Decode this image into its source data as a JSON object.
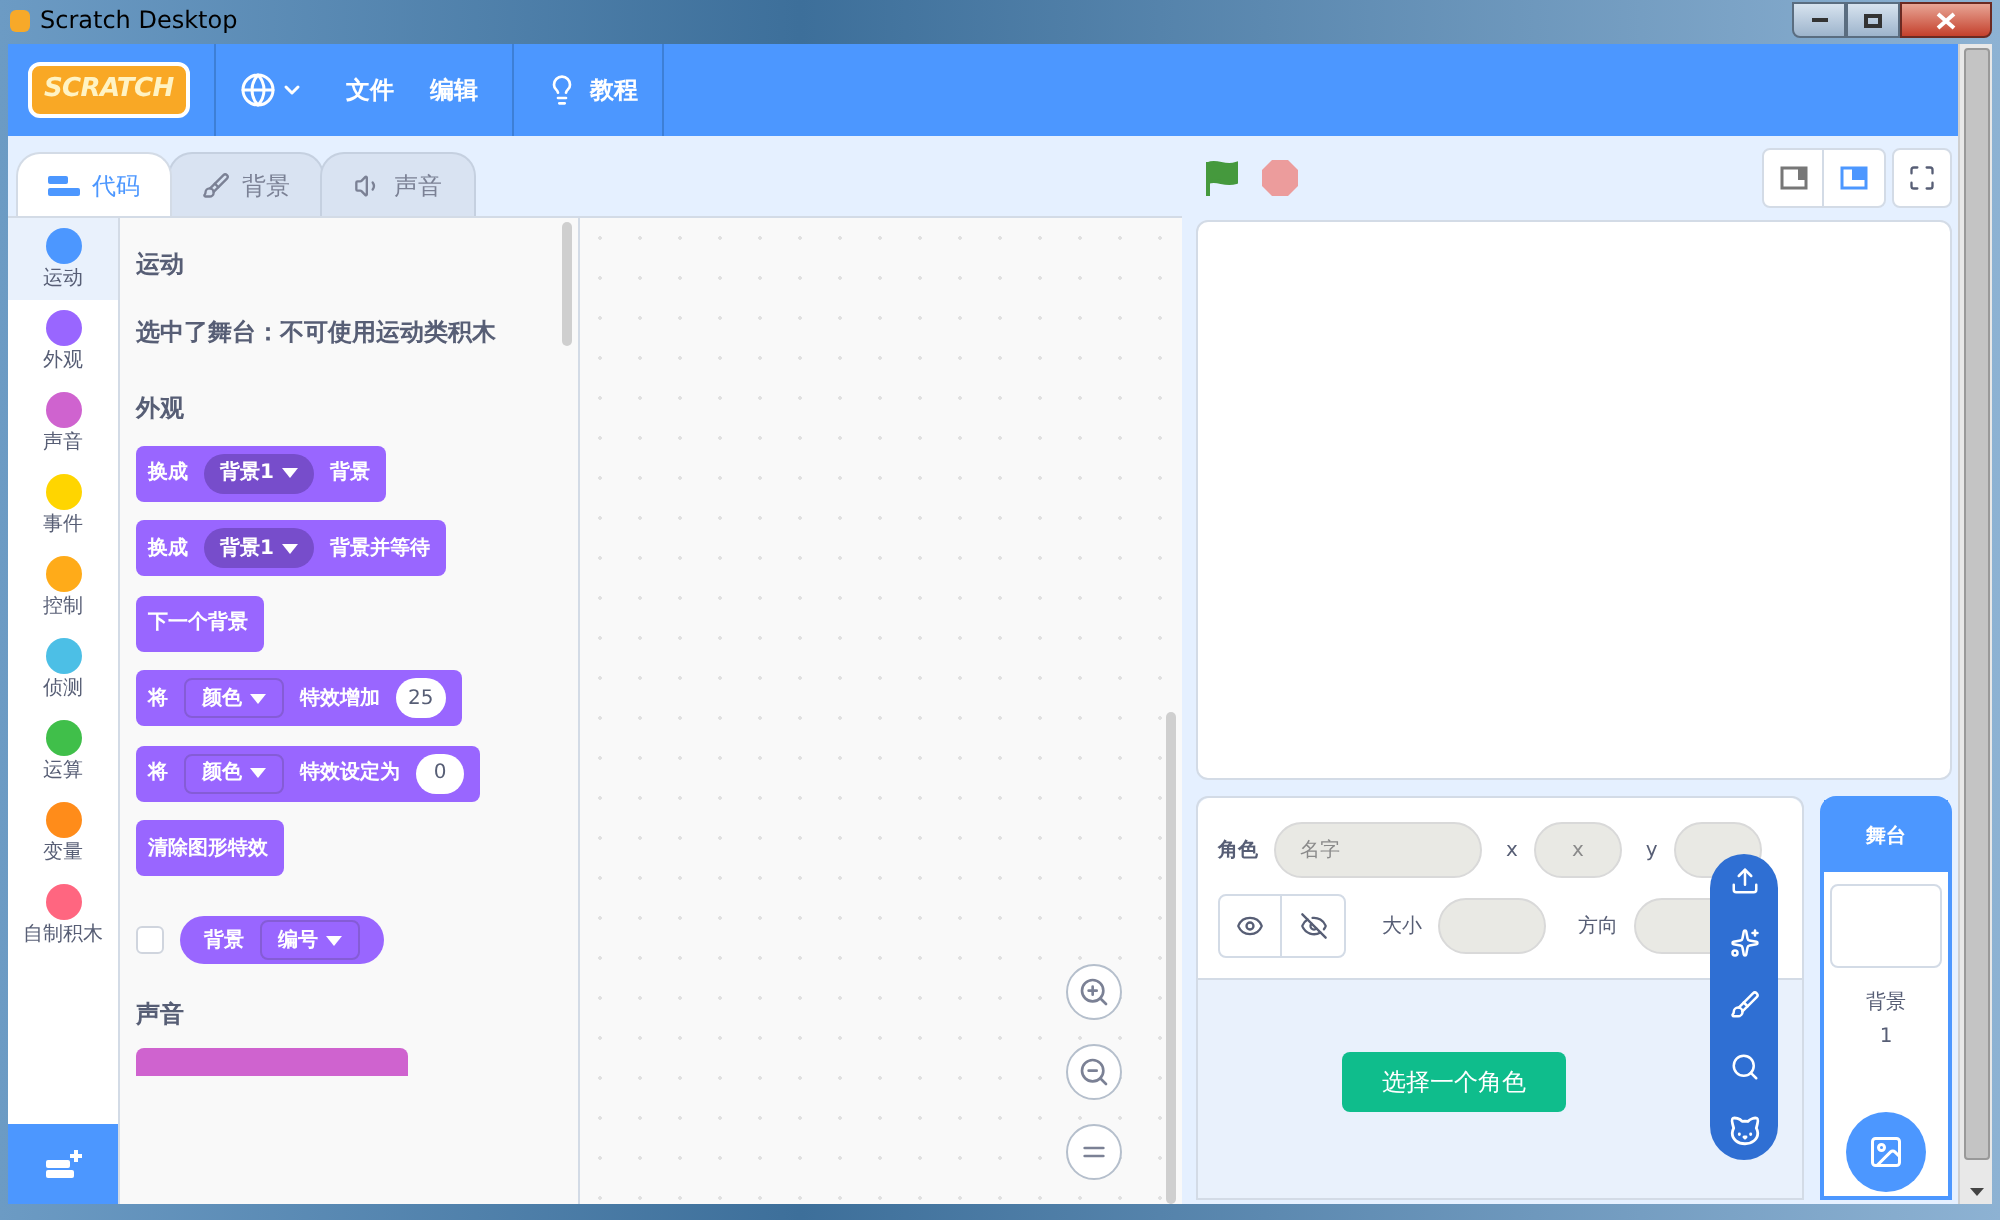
{
  "window": {
    "title": "Scratch Desktop"
  },
  "menu_bar": {
    "logo": "SCRATCH",
    "items": [
      "文件",
      "编辑"
    ],
    "tutorials": "教程"
  },
  "tabs": [
    {
      "label": "代码",
      "selected": true
    },
    {
      "label": "背景",
      "selected": false
    },
    {
      "label": "声音",
      "selected": false
    }
  ],
  "categories": [
    {
      "label": "运动",
      "color": "#4c97ff",
      "selected": true
    },
    {
      "label": "外观",
      "color": "#9966ff",
      "selected": false
    },
    {
      "label": "声音",
      "color": "#cf63cf",
      "selected": false
    },
    {
      "label": "事件",
      "color": "#ffd500",
      "selected": false
    },
    {
      "label": "控制",
      "color": "#ffab19",
      "selected": false
    },
    {
      "label": "侦测",
      "color": "#4cbfe6",
      "selected": false
    },
    {
      "label": "运算",
      "color": "#40bf4a",
      "selected": false
    },
    {
      "label": "变量",
      "color": "#ff8c1a",
      "selected": false
    },
    {
      "label": "自制积木",
      "color": "#ff6680",
      "selected": false
    }
  ],
  "palette": [
    {
      "kind": "heading",
      "text": "运动"
    },
    {
      "kind": "note",
      "text": "选中了舞台：不可使用运动类积木"
    },
    {
      "kind": "heading",
      "text": "外观"
    },
    {
      "kind": "block",
      "color": "#9966ff",
      "parts": [
        {
          "kind": "text",
          "text": "换成"
        },
        {
          "kind": "dropdown",
          "text": "背景1"
        },
        {
          "kind": "text",
          "text": "背景"
        }
      ]
    },
    {
      "kind": "block",
      "color": "#9966ff",
      "parts": [
        {
          "kind": "text",
          "text": "换成"
        },
        {
          "kind": "dropdown",
          "text": "背景1"
        },
        {
          "kind": "text",
          "text": "背景并等待"
        }
      ]
    },
    {
      "kind": "block",
      "color": "#9966ff",
      "parts": [
        {
          "kind": "text",
          "text": "下一个背景"
        }
      ]
    },
    {
      "kind": "block",
      "color": "#9966ff",
      "parts": [
        {
          "kind": "text",
          "text": "将"
        },
        {
          "kind": "menu",
          "text": "颜色"
        },
        {
          "kind": "text",
          "text": "特效增加"
        },
        {
          "kind": "number",
          "text": "25"
        }
      ]
    },
    {
      "kind": "block",
      "color": "#9966ff",
      "parts": [
        {
          "kind": "text",
          "text": "将"
        },
        {
          "kind": "menu",
          "text": "颜色"
        },
        {
          "kind": "text",
          "text": "特效设定为"
        },
        {
          "kind": "number",
          "text": "0"
        }
      ]
    },
    {
      "kind": "block",
      "color": "#9966ff",
      "parts": [
        {
          "kind": "text",
          "text": "清除图形特效"
        }
      ]
    },
    {
      "kind": "reporter",
      "color": "#9966ff",
      "checked": false,
      "parts": [
        {
          "kind": "text",
          "text": "背景"
        },
        {
          "kind": "menu",
          "text": "编号"
        }
      ]
    },
    {
      "kind": "heading",
      "text": "声音"
    },
    {
      "kind": "partial",
      "color": "#cf63cf"
    }
  ],
  "sprite_info": {
    "sprite_label": "角色",
    "name_placeholder": "名字",
    "x_label": "x",
    "x_placeholder": "x",
    "y_label": "y",
    "size_label": "大小",
    "direction_label": "方向",
    "choose_sprite": "选择一个角色"
  },
  "stage_panel": {
    "title": "舞台",
    "backdrops_label": "背景",
    "backdrop_count": "1"
  }
}
